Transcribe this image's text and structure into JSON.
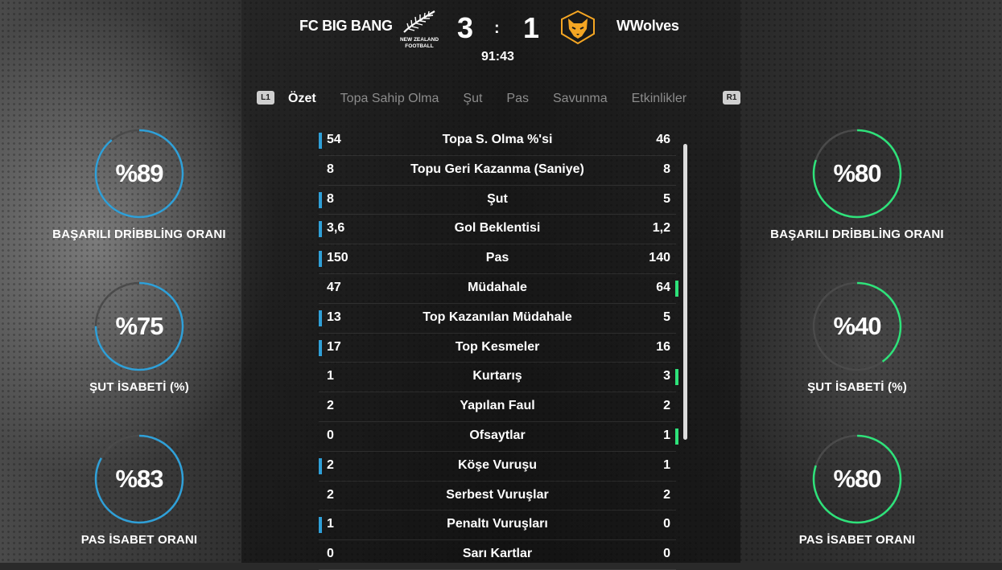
{
  "match": {
    "home_team": "FC BIG BANG",
    "away_team": "WWolves",
    "home_score": "3",
    "separator": ":",
    "away_score": "1",
    "time": "91:43",
    "home_crest": {
      "icon": "fern-crest-icon",
      "text_line1": "NEW ZEALAND",
      "text_line2": "FOOTBALL"
    },
    "away_crest": {
      "icon": "wolf-crest-icon",
      "color": "#f5a623"
    }
  },
  "tabs": {
    "left_button": "L1",
    "right_button": "R1",
    "items": [
      {
        "label": "Özet",
        "active": true
      },
      {
        "label": "Topa Sahip Olma",
        "active": false
      },
      {
        "label": "Şut",
        "active": false
      },
      {
        "label": "Pas",
        "active": false
      },
      {
        "label": "Savunma",
        "active": false
      },
      {
        "label": "Etkinlikler",
        "active": false
      }
    ]
  },
  "colors": {
    "home_accent": "#2fa0d8",
    "away_accent": "#2ee27a",
    "gauge_track": "#4a4a4a"
  },
  "home_gauges": [
    {
      "value_text": "%89",
      "percent": 89,
      "label": "BAŞARILI DRİBBLİNG ORANI"
    },
    {
      "value_text": "%75",
      "percent": 75,
      "label": "ŞUT İSABETİ (%)"
    },
    {
      "value_text": "%83",
      "percent": 83,
      "label": "PAS İSABET ORANI"
    }
  ],
  "away_gauges": [
    {
      "value_text": "%80",
      "percent": 80,
      "label": "BAŞARILI DRİBBLİNG ORANI"
    },
    {
      "value_text": "%40",
      "percent": 40,
      "label": "ŞUT İSABETİ (%)"
    },
    {
      "value_text": "%80",
      "percent": 80,
      "label": "PAS İSABET ORANI"
    }
  ],
  "stats": [
    {
      "home": "54",
      "name": "Topa S. Olma %'si",
      "away": "46",
      "leader": "home"
    },
    {
      "home": "8",
      "name": "Topu Geri Kazanma (Saniye)",
      "away": "8",
      "leader": "none"
    },
    {
      "home": "8",
      "name": "Şut",
      "away": "5",
      "leader": "home"
    },
    {
      "home": "3,6",
      "name": "Gol Beklentisi",
      "away": "1,2",
      "leader": "home"
    },
    {
      "home": "150",
      "name": "Pas",
      "away": "140",
      "leader": "home"
    },
    {
      "home": "47",
      "name": "Müdahale",
      "away": "64",
      "leader": "away"
    },
    {
      "home": "13",
      "name": "Top Kazanılan Müdahale",
      "away": "5",
      "leader": "home"
    },
    {
      "home": "17",
      "name": "Top Kesmeler",
      "away": "16",
      "leader": "home"
    },
    {
      "home": "1",
      "name": "Kurtarış",
      "away": "3",
      "leader": "away"
    },
    {
      "home": "2",
      "name": "Yapılan Faul",
      "away": "2",
      "leader": "none"
    },
    {
      "home": "0",
      "name": "Ofsaytlar",
      "away": "1",
      "leader": "away"
    },
    {
      "home": "2",
      "name": "Köşe Vuruşu",
      "away": "1",
      "leader": "home"
    },
    {
      "home": "2",
      "name": "Serbest Vuruşlar",
      "away": "2",
      "leader": "none"
    },
    {
      "home": "1",
      "name": "Penaltı Vuruşları",
      "away": "0",
      "leader": "home"
    },
    {
      "home": "0",
      "name": "Sarı Kartlar",
      "away": "0",
      "leader": "none"
    }
  ]
}
